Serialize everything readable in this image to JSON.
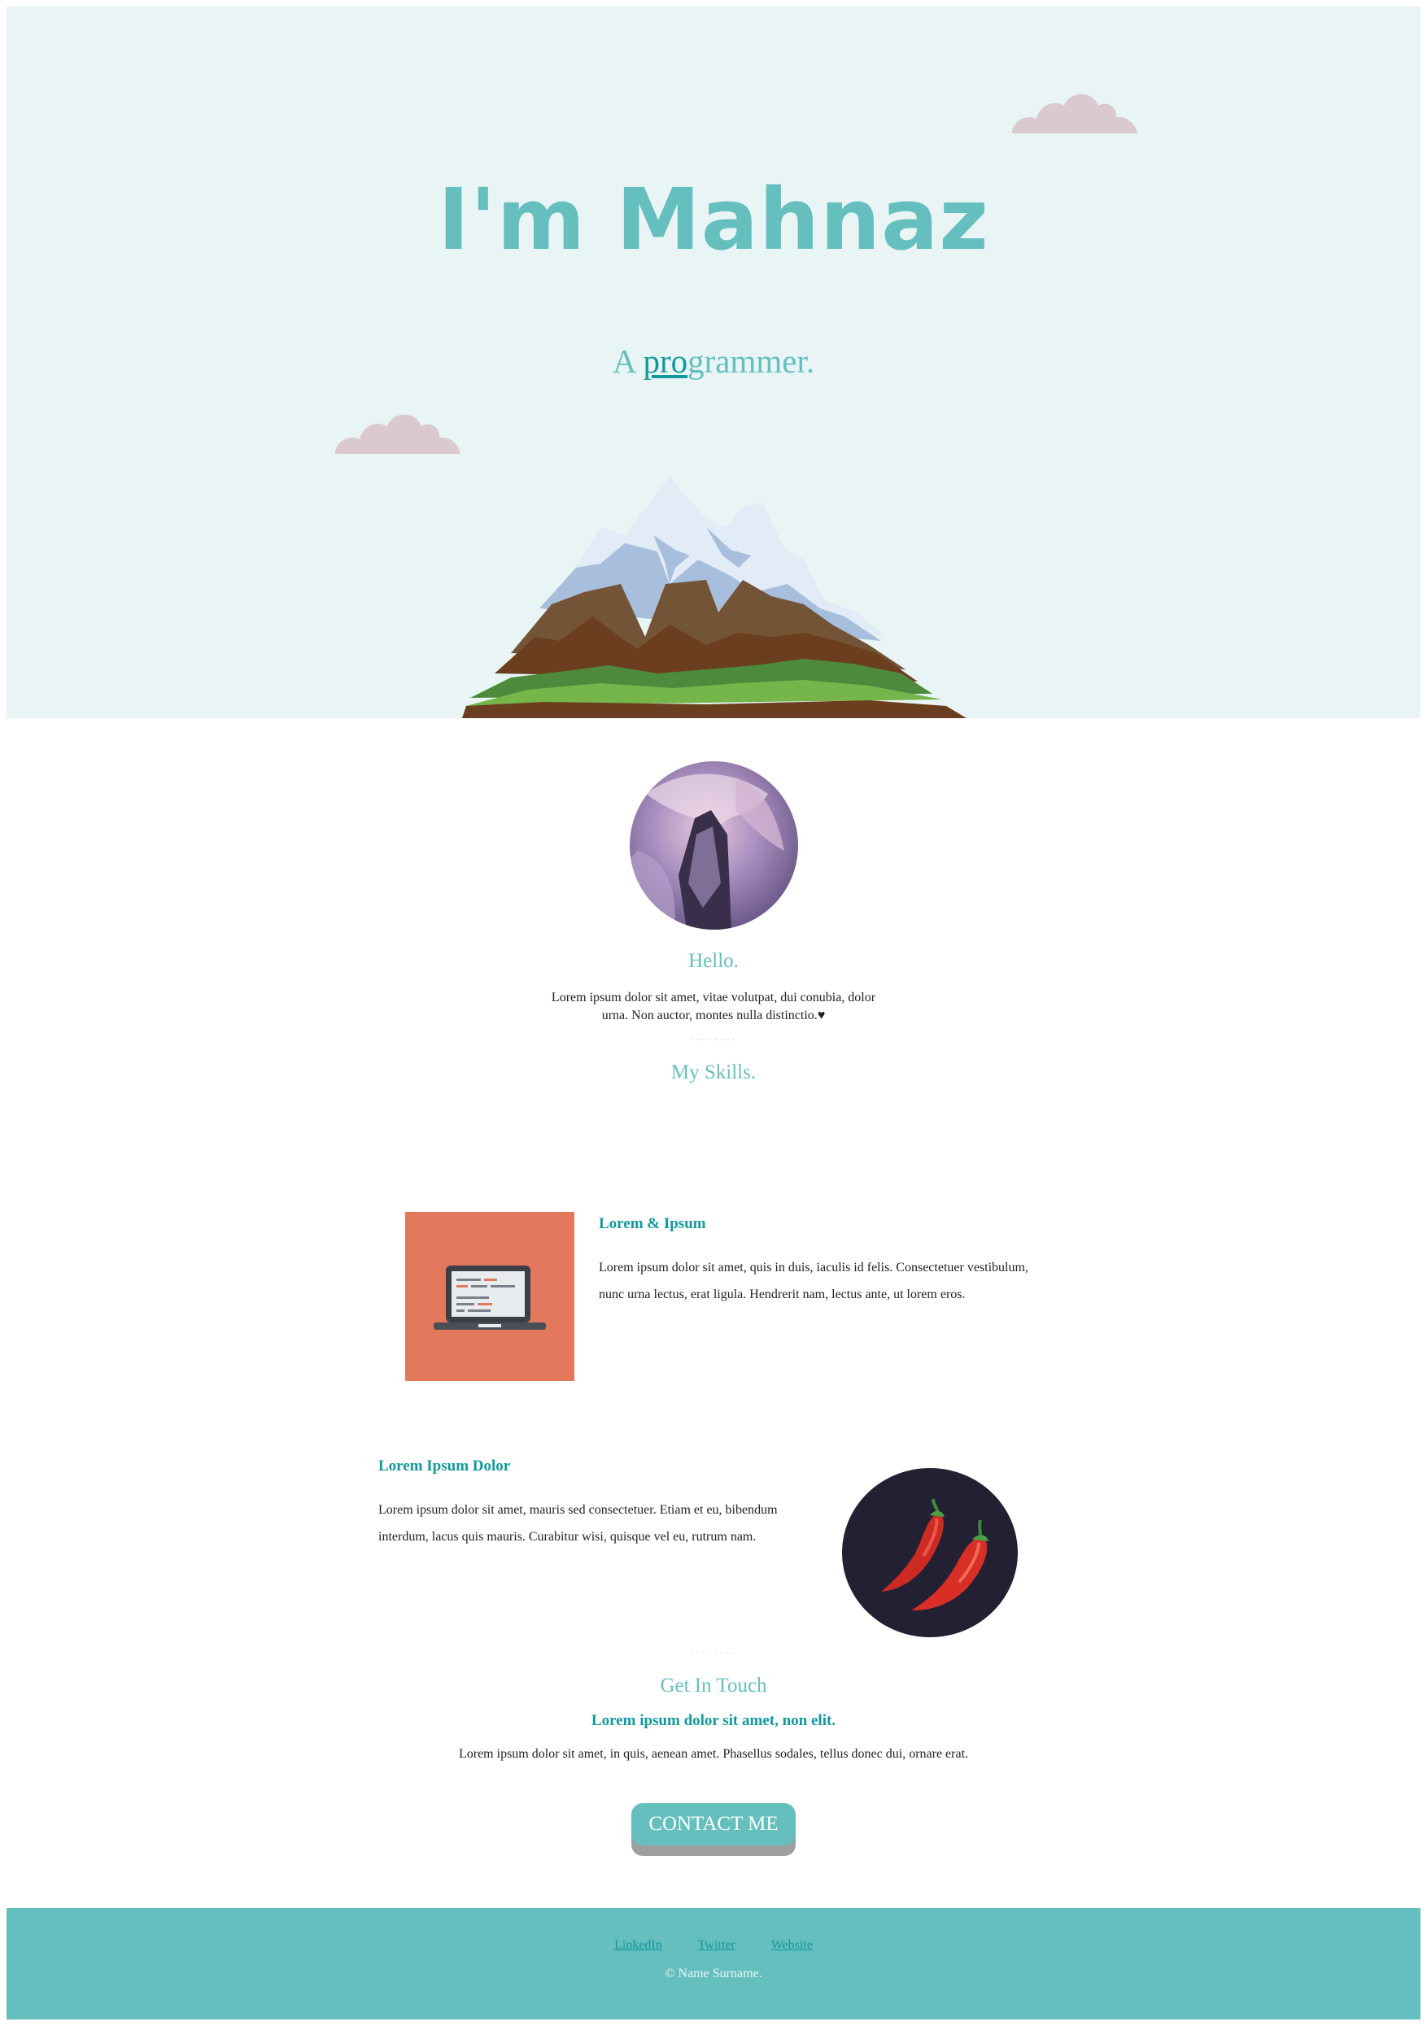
{
  "hero": {
    "title": "I'm Mahnaz",
    "subtitle_prefix": "A ",
    "subtitle_link": "pro",
    "subtitle_suffix": "grammer."
  },
  "about": {
    "heading": "Hello.",
    "text": "Lorem ipsum dolor sit amet, vitae volutpat, dui conubia, dolor urna. Non auctor, montes nulla distinctio.♥"
  },
  "divider": "·.......",
  "skills": {
    "heading": "My Skills.",
    "items": [
      {
        "title": "Lorem & Ipsum",
        "text": "Lorem ipsum dolor sit amet, quis in duis, iaculis id felis. Consectetuer vestibulum, nunc urna lectus, erat ligula. Hendrerit nam, lectus ante, ut lorem eros.",
        "icon": "laptop-icon"
      },
      {
        "title": "Lorem Ipsum Dolor",
        "text": "Lorem ipsum dolor sit amet, mauris sed consectetuer. Etiam et eu, bibendum interdum, lacus quis mauris. Curabitur wisi, quisque vel eu, rutrum nam.",
        "icon": "chili-pepper-icon"
      }
    ]
  },
  "contact": {
    "heading": "Get In Touch",
    "subheading": "Lorem ipsum dolor sit amet, non elit.",
    "text": "Lorem ipsum dolor sit amet, in quis, aenean amet. Phasellus sodales, tellus donec dui, ornare erat.",
    "button": "CONTACT ME"
  },
  "footer": {
    "links": [
      "LinkedIn",
      "Twitter",
      "Website"
    ],
    "copyright": "© Name Surname."
  },
  "colors": {
    "hero_bg": "#e8f5f4",
    "accent": "#66bfbf",
    "accent_dark": "#11999e",
    "skill_tile": "#e4785d",
    "cloud": "#dbc9d0"
  }
}
